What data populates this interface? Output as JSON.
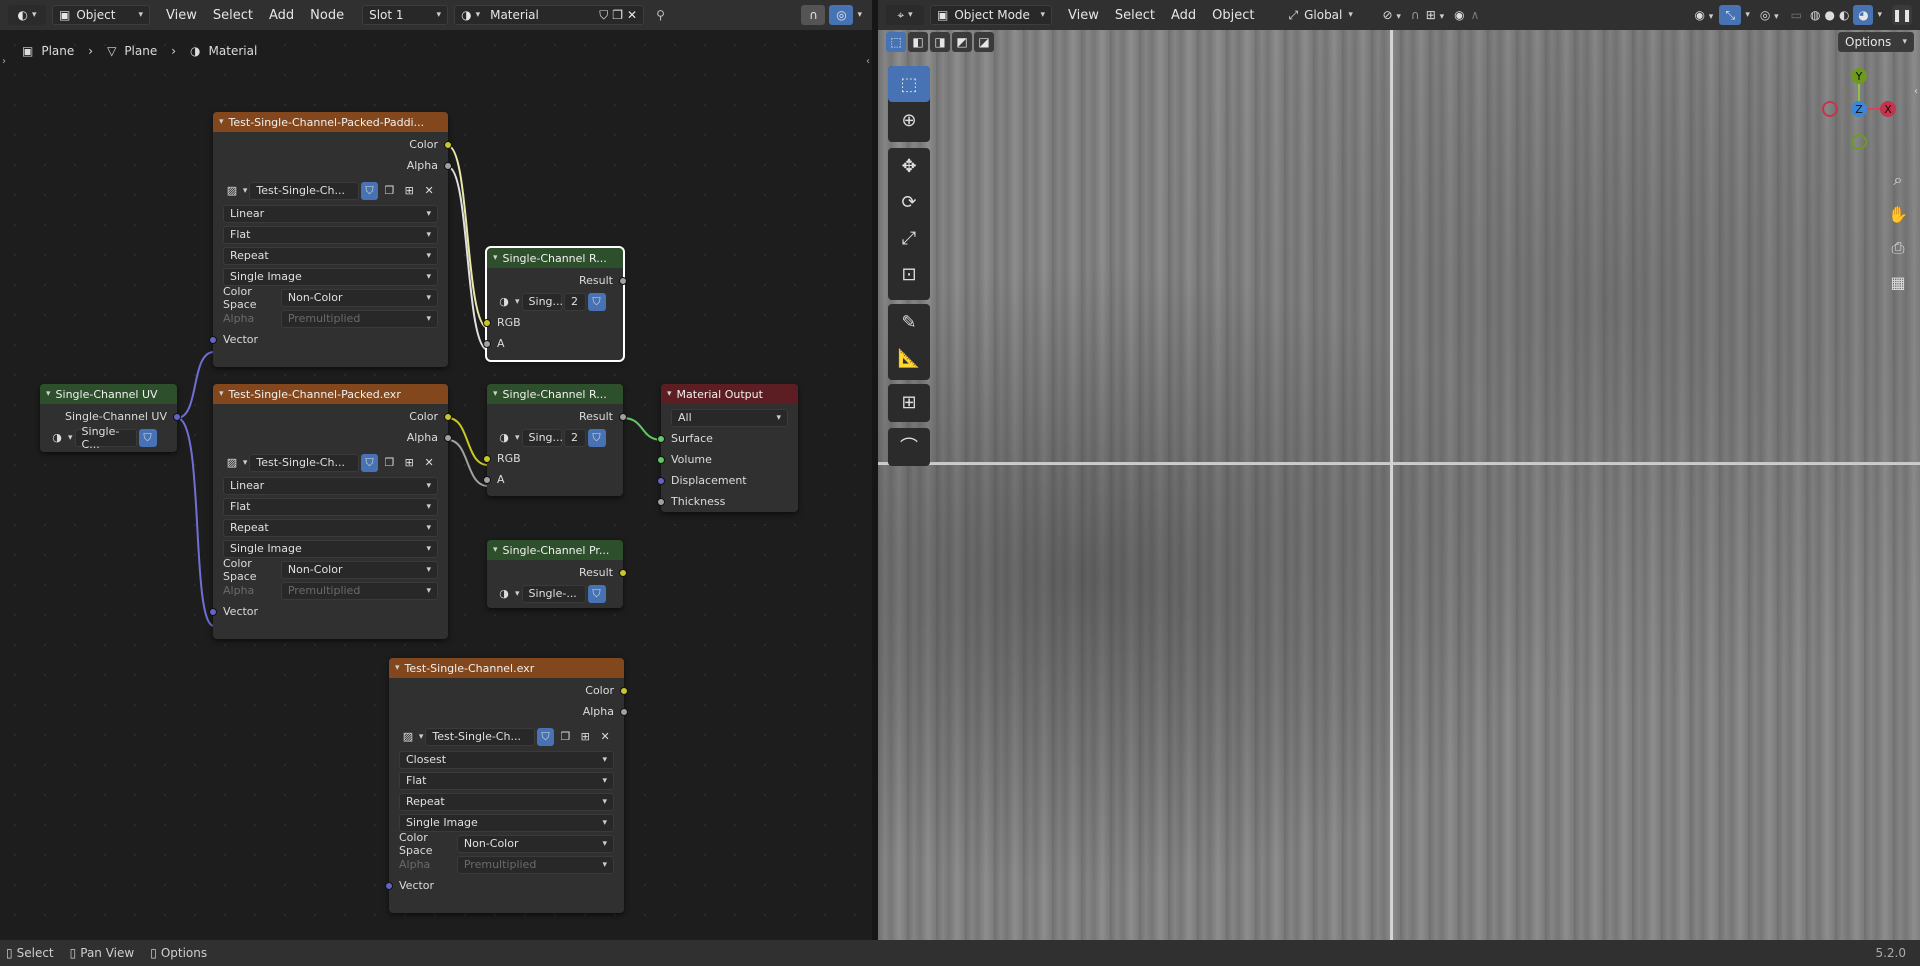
{
  "node_header": {
    "editor_type": "Object",
    "menus": [
      "View",
      "Select",
      "Add",
      "Node"
    ],
    "slot": "Slot 1",
    "material": "Material"
  },
  "breadcrumb": [
    "Plane",
    "Plane",
    "Material"
  ],
  "view_header": {
    "mode": "Object Mode",
    "menus": [
      "View",
      "Select",
      "Add",
      "Object"
    ],
    "orientation": "Global",
    "options": "Options"
  },
  "nodes": {
    "n1": {
      "title": "Test-Single-Channel-Packed-Paddi...",
      "out_color": "Color",
      "out_alpha": "Alpha",
      "image": "Test-Single-Ch...",
      "interp": "Linear",
      "proj": "Flat",
      "ext": "Repeat",
      "src": "Single Image",
      "cs_label": "Color Space",
      "cs": "Non-Color",
      "alpha_label": "Alpha",
      "alpha": "Premultiplied",
      "in_vec": "Vector"
    },
    "n2": {
      "title": "Test-Single-Channel-Packed.exr",
      "out_color": "Color",
      "out_alpha": "Alpha",
      "image": "Test-Single-Ch...",
      "interp": "Linear",
      "proj": "Flat",
      "ext": "Repeat",
      "src": "Single Image",
      "cs_label": "Color Space",
      "cs": "Non-Color",
      "alpha_label": "Alpha",
      "alpha": "Premultiplied",
      "in_vec": "Vector"
    },
    "n3": {
      "title": "Test-Single-Channel.exr",
      "out_color": "Color",
      "out_alpha": "Alpha",
      "image": "Test-Single-Ch...",
      "interp": "Closest",
      "proj": "Flat",
      "ext": "Repeat",
      "src": "Single Image",
      "cs_label": "Color Space",
      "cs": "Non-Color",
      "alpha_label": "Alpha",
      "alpha": "Premultiplied",
      "in_vec": "Vector"
    },
    "uv": {
      "title": "Single-Channel UV",
      "out": "Single-Channel UV",
      "grp": "Single-C..."
    },
    "g1": {
      "title": "Single-Channel R...",
      "out": "Result",
      "grp": "Sing...",
      "users": "2",
      "in_rgb": "RGB",
      "in_a": "A"
    },
    "g2": {
      "title": "Single-Channel R...",
      "out": "Result",
      "grp": "Sing...",
      "users": "2",
      "in_rgb": "RGB",
      "in_a": "A"
    },
    "g3": {
      "title": "Single-Channel Pr...",
      "out": "Result",
      "grp": "Single-..."
    },
    "mo": {
      "title": "Material Output",
      "target": "All",
      "in_surface": "Surface",
      "in_volume": "Volume",
      "in_disp": "Displacement",
      "in_thick": "Thickness"
    }
  },
  "gizmo": {
    "y": "Y",
    "z": "Z",
    "x": "X"
  },
  "status": {
    "select": "Select",
    "pan": "Pan View",
    "options": "Options",
    "version": "5.2.0"
  }
}
